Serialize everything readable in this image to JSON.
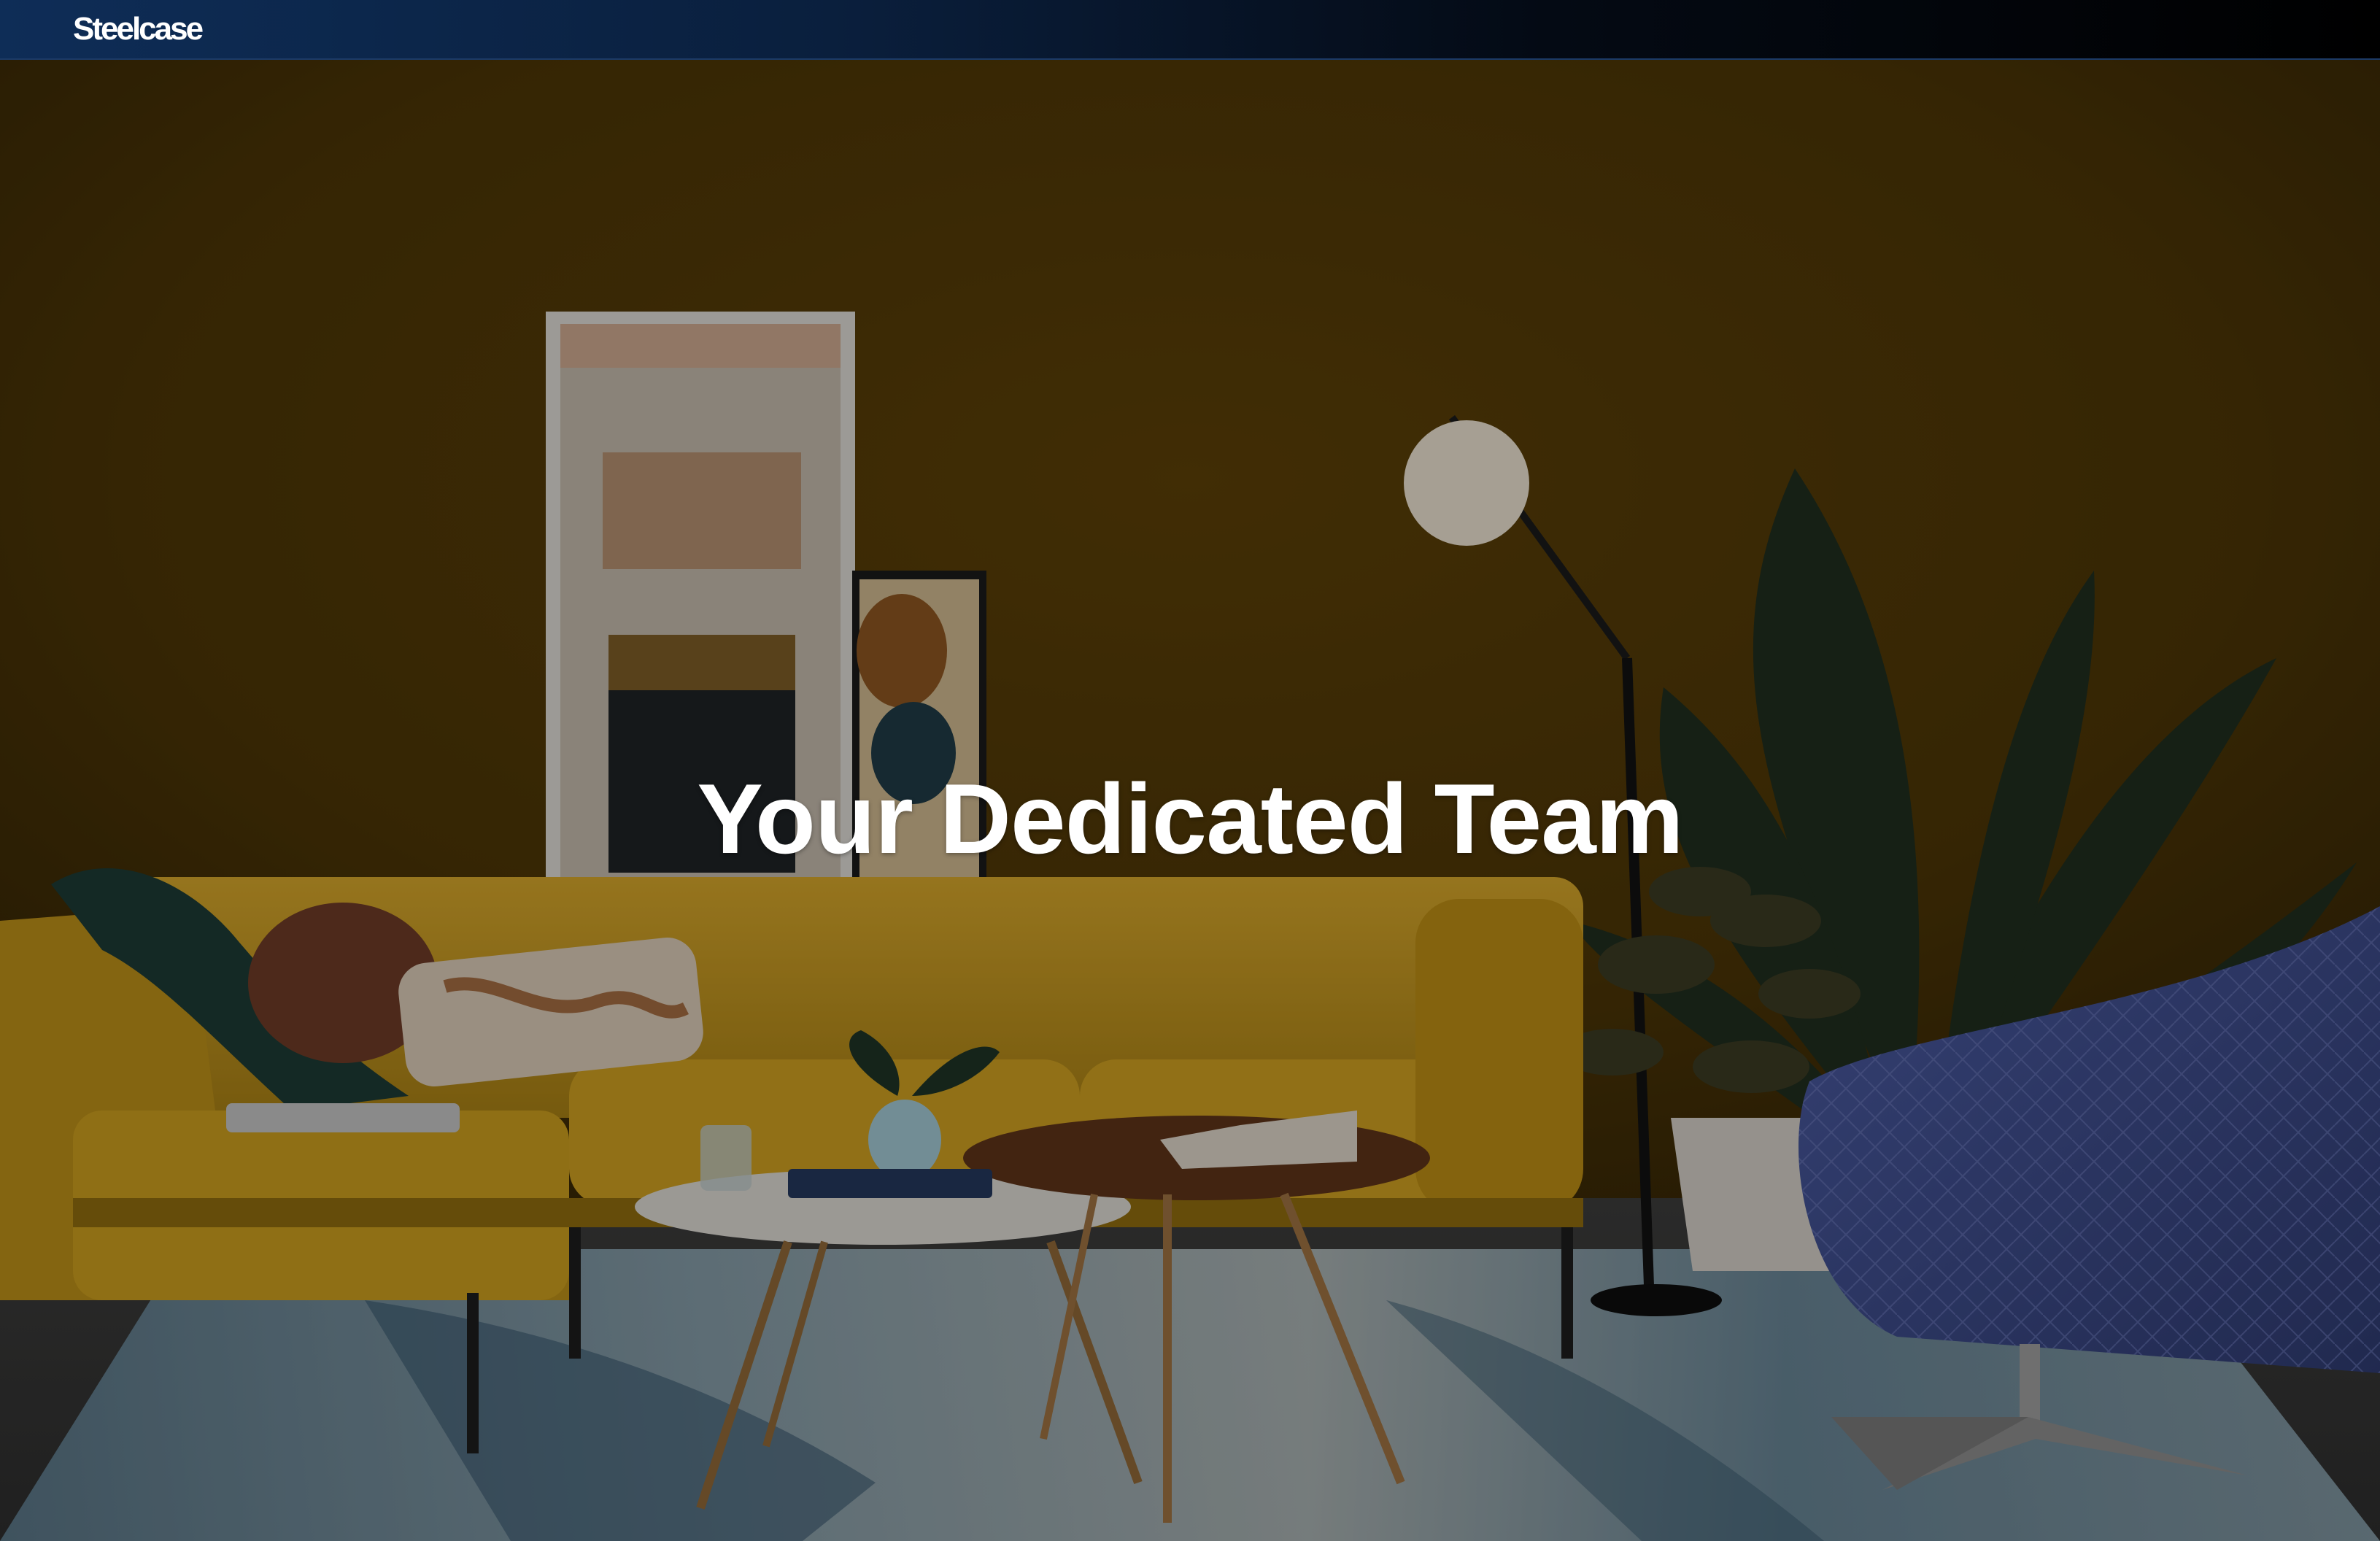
{
  "header": {
    "brand": "Steelcase"
  },
  "hero": {
    "title": "Your Dedicated Team",
    "image_subject": "living-room-scene"
  },
  "colors": {
    "nav_left": "#0e2d57",
    "nav_right": "#000000",
    "wall": "#4a3406",
    "sofa": "#c79a1e",
    "chair": "#3b4a87",
    "title_text": "#ffffff"
  }
}
